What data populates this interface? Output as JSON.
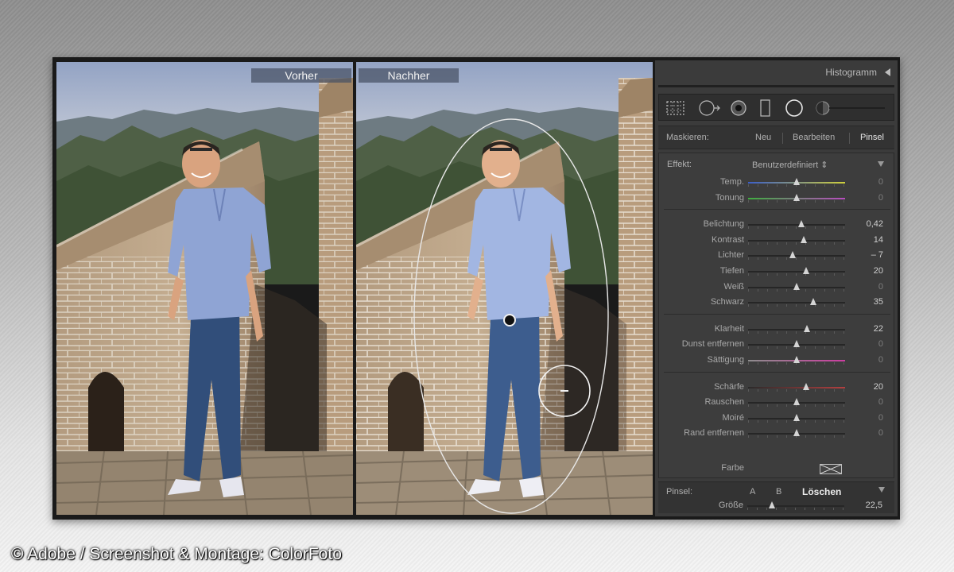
{
  "photo_labels": {
    "before": "Vorher",
    "after": "Nachher"
  },
  "panel": {
    "histogram_title": "Histogramm",
    "mask": {
      "label": "Maskieren:",
      "new": "Neu",
      "edit": "Bearbeiten",
      "brush": "Pinsel"
    },
    "effect": {
      "label": "Effekt:",
      "value": "Benutzerdefiniert ⇕"
    },
    "groups": [
      [
        {
          "name": "Temp.",
          "value": "0",
          "position": 0.5,
          "track": "temp"
        },
        {
          "name": "Tonung",
          "value": "0",
          "position": 0.5,
          "track": "tint"
        }
      ],
      [
        {
          "name": "Belichtung",
          "value": "0,42",
          "position": 0.55
        },
        {
          "name": "Kontrast",
          "value": "14",
          "position": 0.57
        },
        {
          "name": "Lichter",
          "value": "– 7",
          "position": 0.46
        },
        {
          "name": "Tiefen",
          "value": "20",
          "position": 0.6
        },
        {
          "name": "Weiß",
          "value": "0",
          "position": 0.5
        },
        {
          "name": "Schwarz",
          "value": "35",
          "position": 0.67
        }
      ],
      [
        {
          "name": "Klarheit",
          "value": "22",
          "position": 0.61
        },
        {
          "name": "Dunst entfernen",
          "value": "0",
          "position": 0.5
        },
        {
          "name": "Sättigung",
          "value": "0",
          "position": 0.5,
          "track": "sat"
        }
      ],
      [
        {
          "name": "Schärfe",
          "value": "20",
          "position": 0.6,
          "track": "sharp"
        },
        {
          "name": "Rauschen",
          "value": "0",
          "position": 0.5
        },
        {
          "name": "Moiré",
          "value": "0",
          "position": 0.5
        },
        {
          "name": "Rand entfernen",
          "value": "0",
          "position": 0.5
        }
      ]
    ],
    "color_label": "Farbe",
    "brush": {
      "label": "Pinsel:",
      "a": "A",
      "b": "B",
      "erase": "Löschen",
      "size_label": "Größe",
      "size_value": "22,5",
      "size_position": 0.25
    }
  },
  "caption": "© Adobe / Screenshot & Montage: ColorFoto"
}
